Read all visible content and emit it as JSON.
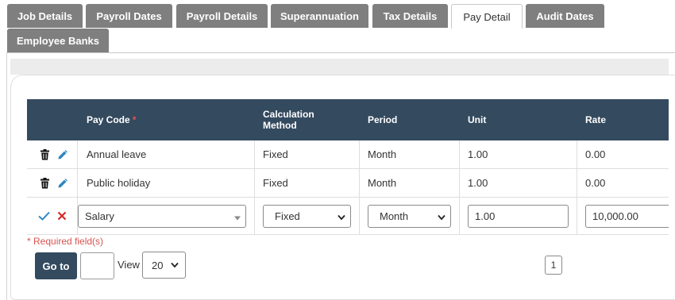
{
  "tabs": [
    {
      "label": "Job Details",
      "active": false
    },
    {
      "label": "Payroll Dates",
      "active": false
    },
    {
      "label": "Payroll Details",
      "active": false
    },
    {
      "label": "Superannuation",
      "active": false
    },
    {
      "label": "Tax Details",
      "active": false
    },
    {
      "label": "Pay Detail",
      "active": true
    },
    {
      "label": "Audit Dates",
      "active": false
    },
    {
      "label": "Employee Banks",
      "active": false
    }
  ],
  "grid": {
    "columns": {
      "pay_code": "Pay Code",
      "pay_code_required_marker": "*",
      "calc_method_line1": "Calculation",
      "calc_method_line2": "Method",
      "period": "Period",
      "unit": "Unit",
      "rate": "Rate"
    },
    "rows": [
      {
        "pay_code": "Annual leave",
        "calc_method": "Fixed",
        "period": "Month",
        "unit": "1.00",
        "rate": "0.00"
      },
      {
        "pay_code": "Public holiday",
        "calc_method": "Fixed",
        "period": "Month",
        "unit": "1.00",
        "rate": "0.00"
      }
    ],
    "edit_row": {
      "pay_code": "Salary",
      "calc_method": "Fixed",
      "period": "Month",
      "unit": "1.00",
      "rate": "10,000.00"
    }
  },
  "footer": {
    "required_note": "* Required field(s)",
    "goto_label": "Go to",
    "page_input_value": "",
    "view_label": "View",
    "view_size": "20",
    "current_page": "1"
  },
  "colors": {
    "header_bg": "#344a5f",
    "tab_bg": "#7f7f7f",
    "required": "#d9534f",
    "confirm": "#2e86c1",
    "cancel": "#d62828",
    "edit_icon": "#2e86c1"
  }
}
